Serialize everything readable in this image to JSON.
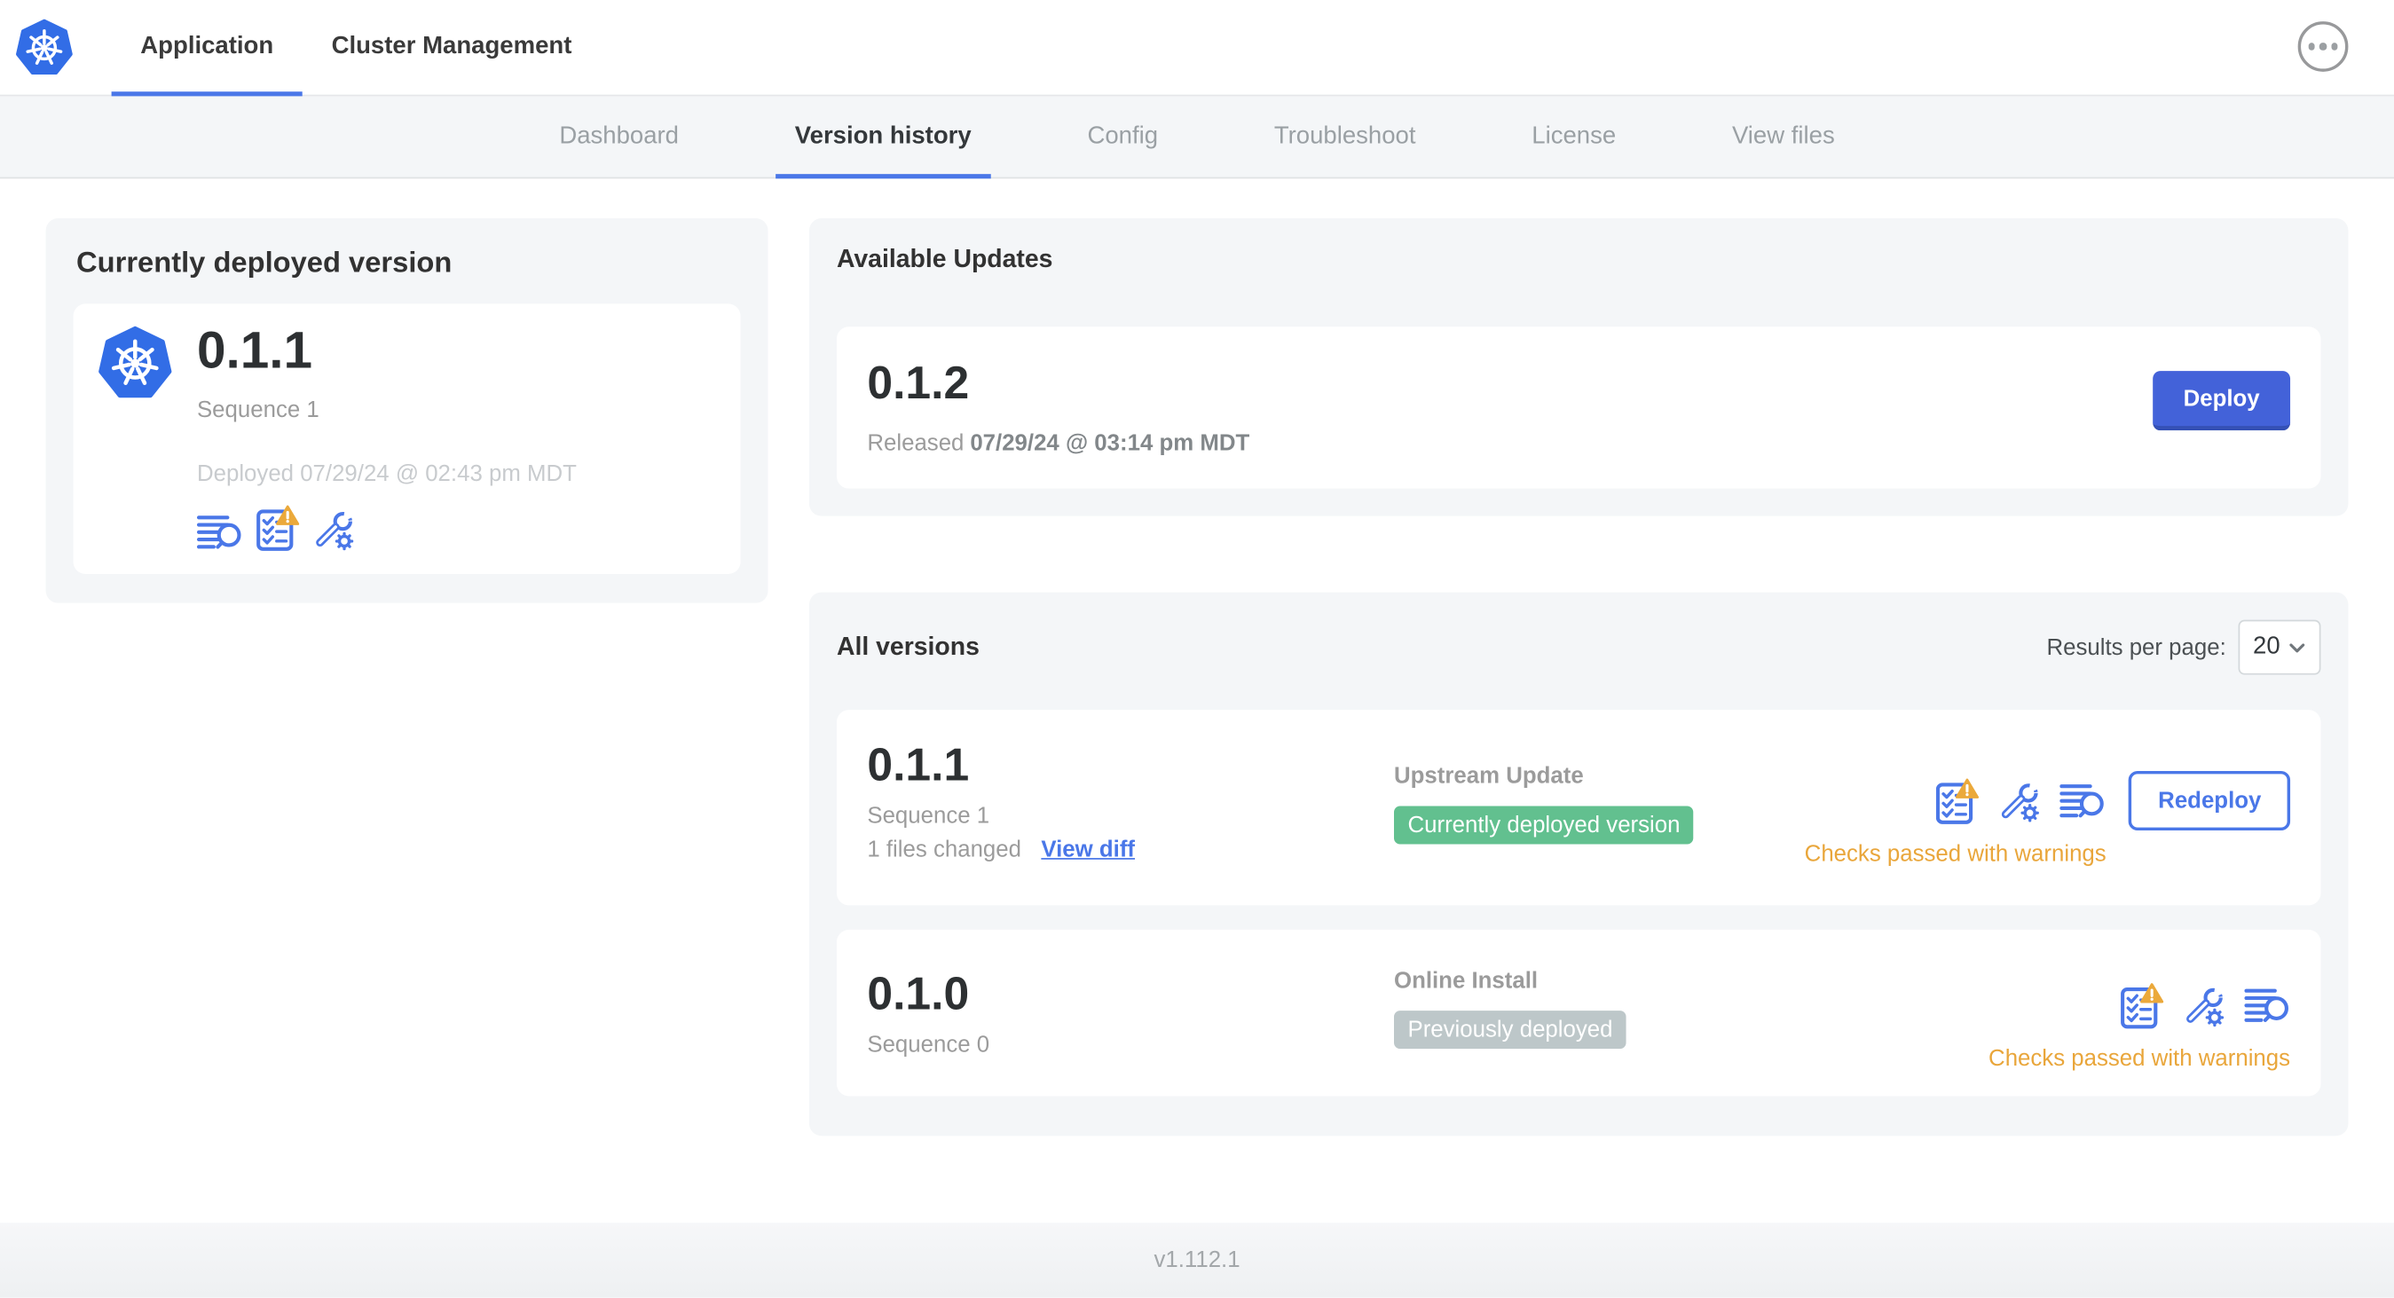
{
  "topnav": {
    "tabs": [
      "Application",
      "Cluster Management"
    ],
    "active_tab": "Application"
  },
  "subnav": {
    "tabs": [
      "Dashboard",
      "Version history",
      "Config",
      "Troubleshoot",
      "License",
      "View files"
    ],
    "active_tab": "Version history"
  },
  "currently_deployed": {
    "title": "Currently deployed version",
    "version": "0.1.1",
    "sequence": "Sequence 1",
    "deployed_at": "Deployed 07/29/24 @ 02:43 pm MDT"
  },
  "available_updates": {
    "title": "Available Updates",
    "version": "0.1.2",
    "released_prefix": "Released",
    "released_date": "07/29/24 @ 03:14 pm MDT",
    "deploy_label": "Deploy"
  },
  "all_versions": {
    "title": "All versions",
    "results_per_page_label": "Results per page:",
    "results_per_page_value": "20",
    "rows": [
      {
        "version": "0.1.1",
        "sequence": "Sequence 1",
        "files_changed": "1 files changed",
        "view_diff_label": "View diff",
        "source": "Upstream Update",
        "badge": "Currently deployed version",
        "badge_type": "green",
        "status": "Checks passed with warnings",
        "action_label": "Redeploy"
      },
      {
        "version": "0.1.0",
        "sequence": "Sequence 0",
        "source": "Online Install",
        "badge": "Previously deployed",
        "badge_type": "gray",
        "status": "Checks passed with warnings"
      }
    ]
  },
  "footer": {
    "app_version": "v1.112.1"
  },
  "icons": {
    "kubernetes-logo": "blue heptagon with white ship helm wheel",
    "menu-ellipsis": "circled three dots",
    "deploy-logs": "text lines with magnifying glass",
    "preflight-checks": "checklist with warning triangle",
    "config": "wrench with gear",
    "chevron-down": "down caret"
  },
  "colors": {
    "accent_blue": "#4a77e8",
    "kubernetes_blue": "#326de6",
    "deploy_button_blue": "#4362d9",
    "badge_green": "#62c08f",
    "badge_gray": "#bdc7c9",
    "warning_amber": "#eba93b",
    "status_orange": "#e9a63b",
    "panel_gray": "#f4f6f8"
  }
}
